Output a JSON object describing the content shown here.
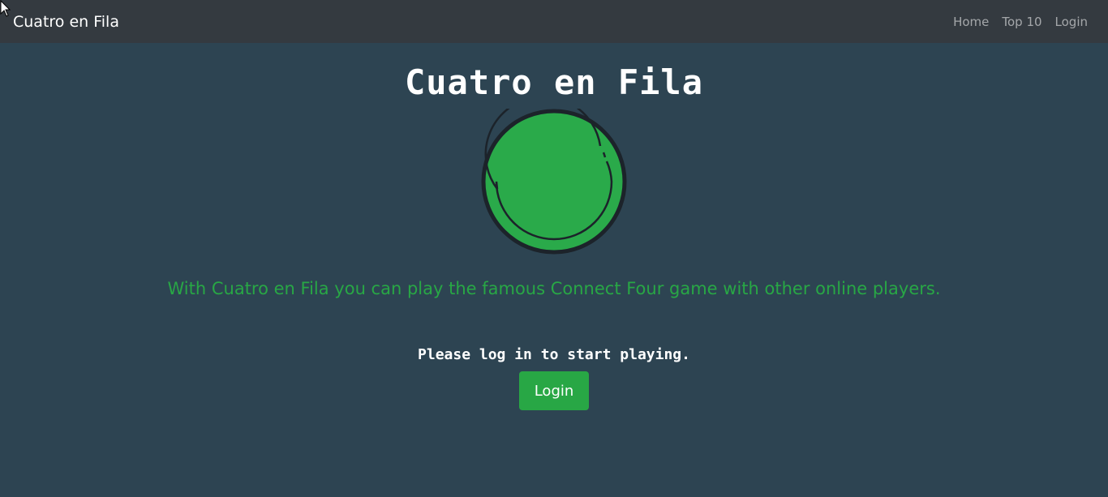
{
  "navbar": {
    "brand": "Cuatro en Fila",
    "links": [
      {
        "label": "Home"
      },
      {
        "label": "Top 10"
      },
      {
        "label": "Login"
      }
    ]
  },
  "main": {
    "title": "Cuatro en Fila",
    "chip_icon": "green-game-chip-icon",
    "tagline": "With Cuatro en Fila you can play the famous Connect Four game with other online players.",
    "prompt": "Please log in to start playing.",
    "login_button": "Login"
  },
  "colors": {
    "navbar_bg": "#343a40",
    "page_bg": "#2d4452",
    "accent_green": "#28a745",
    "chip_outline": "#1c232a"
  }
}
